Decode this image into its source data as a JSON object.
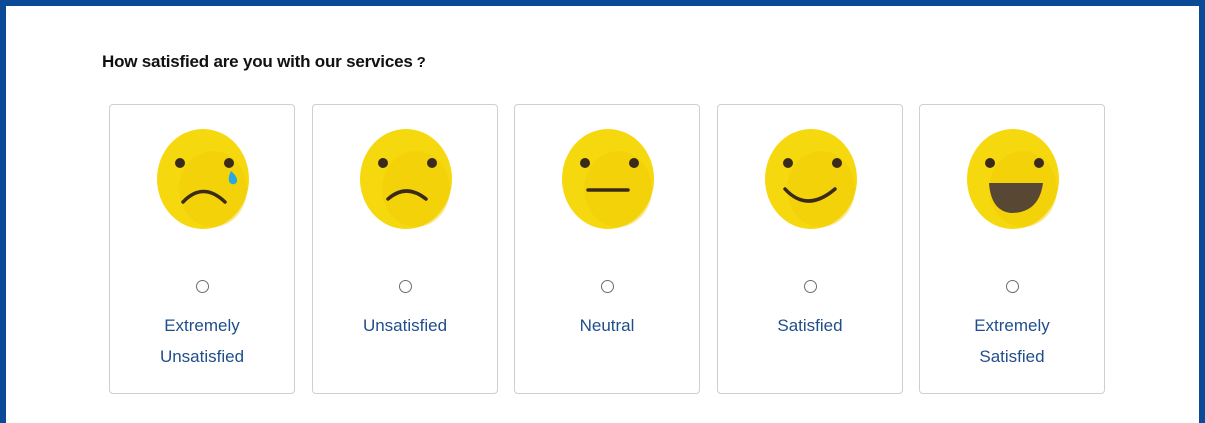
{
  "survey": {
    "question": "How satisfied are you with our services",
    "question_mark": "?",
    "options": [
      {
        "label": "Extremely Unsatisfied",
        "selected": false,
        "icon": "crying-face-icon"
      },
      {
        "label": "Unsatisfied",
        "selected": false,
        "icon": "sad-face-icon"
      },
      {
        "label": "Neutral",
        "selected": false,
        "icon": "neutral-face-icon"
      },
      {
        "label": "Satisfied",
        "selected": false,
        "icon": "smiling-face-icon"
      },
      {
        "label": "Extremely Satisfied",
        "selected": false,
        "icon": "laughing-face-icon"
      }
    ]
  },
  "colors": {
    "frame_border": "#0a4a97",
    "label_text": "#1f4e8a",
    "emoji_face": "#f6d80f",
    "tear": "#29a8e0"
  }
}
